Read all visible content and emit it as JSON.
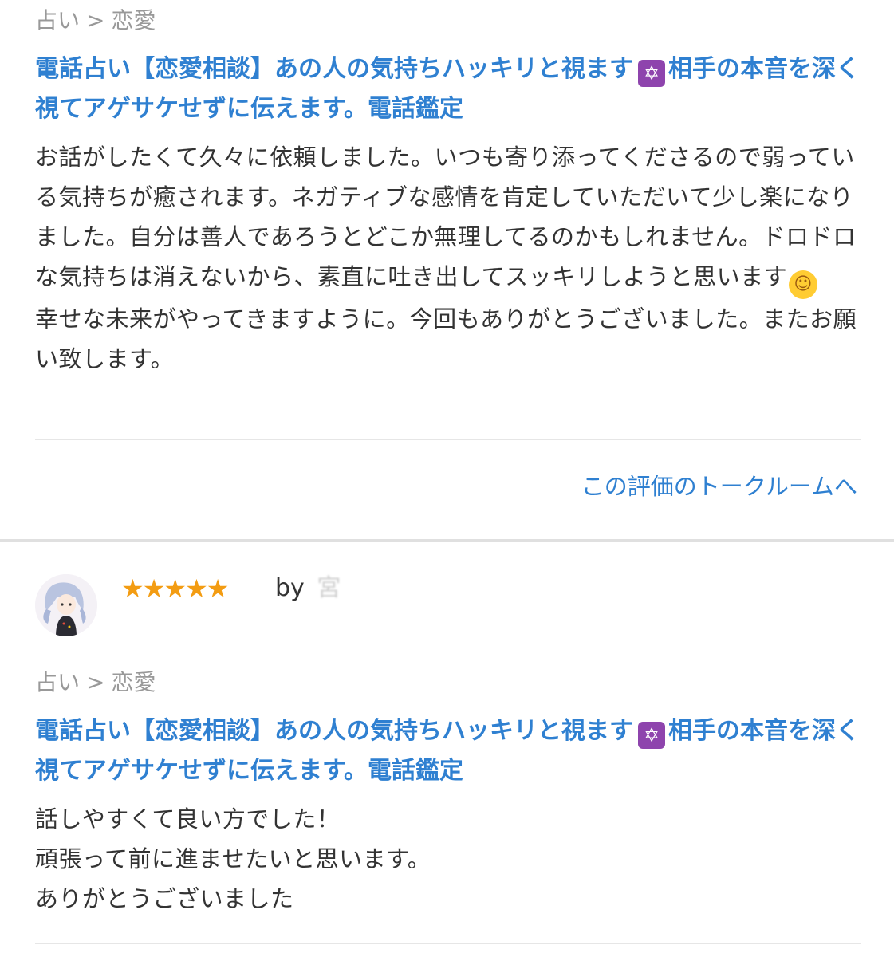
{
  "reviews": [
    {
      "breadcrumb": {
        "category": "占い",
        "separator": ">",
        "subcategory": "恋愛"
      },
      "service_title": {
        "part1": "電話占い【恋愛相談】あの人の気持ちハッキリと視ます",
        "emoji": "✡",
        "part2": "相手の本音を深く視てアゲサケせずに伝えます。電話鑑定"
      },
      "body": {
        "para1": "お話がしたくて久々に依頼しました。いつも寄り添ってくださるので弱っている気持ちが癒されます。ネガティブな感情を肯定していただいて少し楽になりました。自分は善人であろうとどこか無理してるのかもしれません。ドロドロな気持ちは消えないから、素直に吐き出してスッキリしようと思います",
        "para1_emoji": "☺",
        "para2": "幸せな未来がやってきますように。今回もありがとうございました。またお願い致します。"
      },
      "talk_link": "この評価のトークルームへ"
    },
    {
      "rating_stars": "★★★★★",
      "rating": 5,
      "reviewer": {
        "prefix": "by",
        "name": "宮"
      },
      "breadcrumb": {
        "category": "占い",
        "separator": ">",
        "subcategory": "恋愛"
      },
      "service_title": {
        "part1": "電話占い【恋愛相談】あの人の気持ちハッキリと視ます",
        "emoji": "✡",
        "part2": "相手の本音を深く視てアゲサケせずに伝えます。電話鑑定"
      },
      "body": {
        "line1": "話しやすくて良い方でした！",
        "line2": "頑張って前に進ませたいと思います。",
        "line3": "ありがとうございました"
      }
    }
  ],
  "colors": {
    "link_blue": "#2f80d1",
    "star_orange": "#f39c12",
    "muted_gray": "#999999",
    "emoji_purple": "#8e44ad"
  }
}
